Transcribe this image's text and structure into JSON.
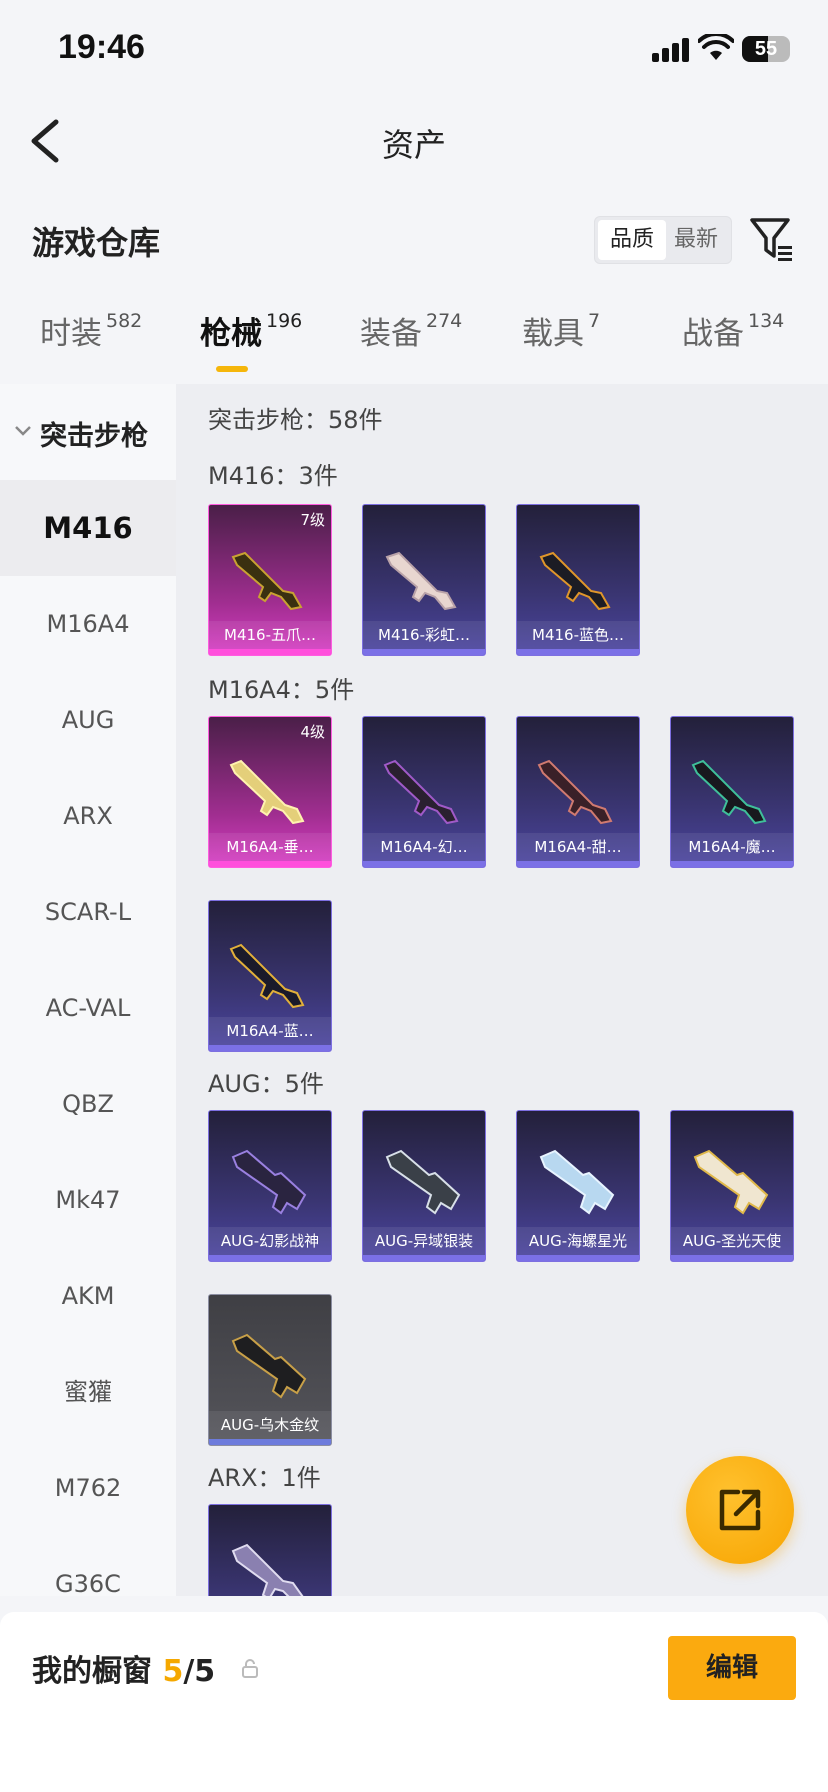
{
  "status_bar": {
    "time": "19:46",
    "battery": "55"
  },
  "nav": {
    "title": "资产"
  },
  "header": {
    "title": "游戏仓库",
    "sort_options": [
      "品质",
      "最新"
    ]
  },
  "tabs": [
    {
      "label": "时装",
      "count": "582"
    },
    {
      "label": "枪械",
      "count": "196"
    },
    {
      "label": "装备",
      "count": "274"
    },
    {
      "label": "载具",
      "count": "7"
    },
    {
      "label": "战备",
      "count": "134"
    }
  ],
  "sidebar": {
    "group": "突击步枪",
    "items": [
      "M416",
      "M16A4",
      "AUG",
      "ARX",
      "SCAR-L",
      "AC-VAL",
      "QBZ",
      "Mk47",
      "AKM",
      "蜜獾",
      "M762",
      "G36C"
    ]
  },
  "main": {
    "summary": "突击步枪：58件",
    "sections": [
      {
        "title": "M416：3件",
        "cards": [
          {
            "name": "M416-五爪…",
            "level": "7级"
          },
          {
            "name": "M416-彩虹…"
          },
          {
            "name": "M416-蓝色…"
          }
        ]
      },
      {
        "title": "M16A4：5件",
        "cards": [
          {
            "name": "M16A4-垂…",
            "level": "4级"
          },
          {
            "name": "M16A4-幻…"
          },
          {
            "name": "M16A4-甜…"
          },
          {
            "name": "M16A4-魔…"
          },
          {
            "name": "M16A4-蓝…"
          }
        ]
      },
      {
        "title": "AUG：5件",
        "cards": [
          {
            "name": "AUG-幻影战神"
          },
          {
            "name": "AUG-异域银装"
          },
          {
            "name": "AUG-海螺星光"
          },
          {
            "name": "AUG-圣光天使"
          },
          {
            "name": "AUG-乌木金纹"
          }
        ]
      },
      {
        "title": "ARX：1件",
        "cards": [
          {
            "name": ""
          }
        ]
      }
    ]
  },
  "bottom": {
    "label": "我的橱窗",
    "current": "5",
    "total": "/5",
    "edit": "编辑"
  },
  "colors": {
    "accent": "#f5b60b",
    "legendary": "#d83ec5",
    "epic": "#4b45a0"
  }
}
